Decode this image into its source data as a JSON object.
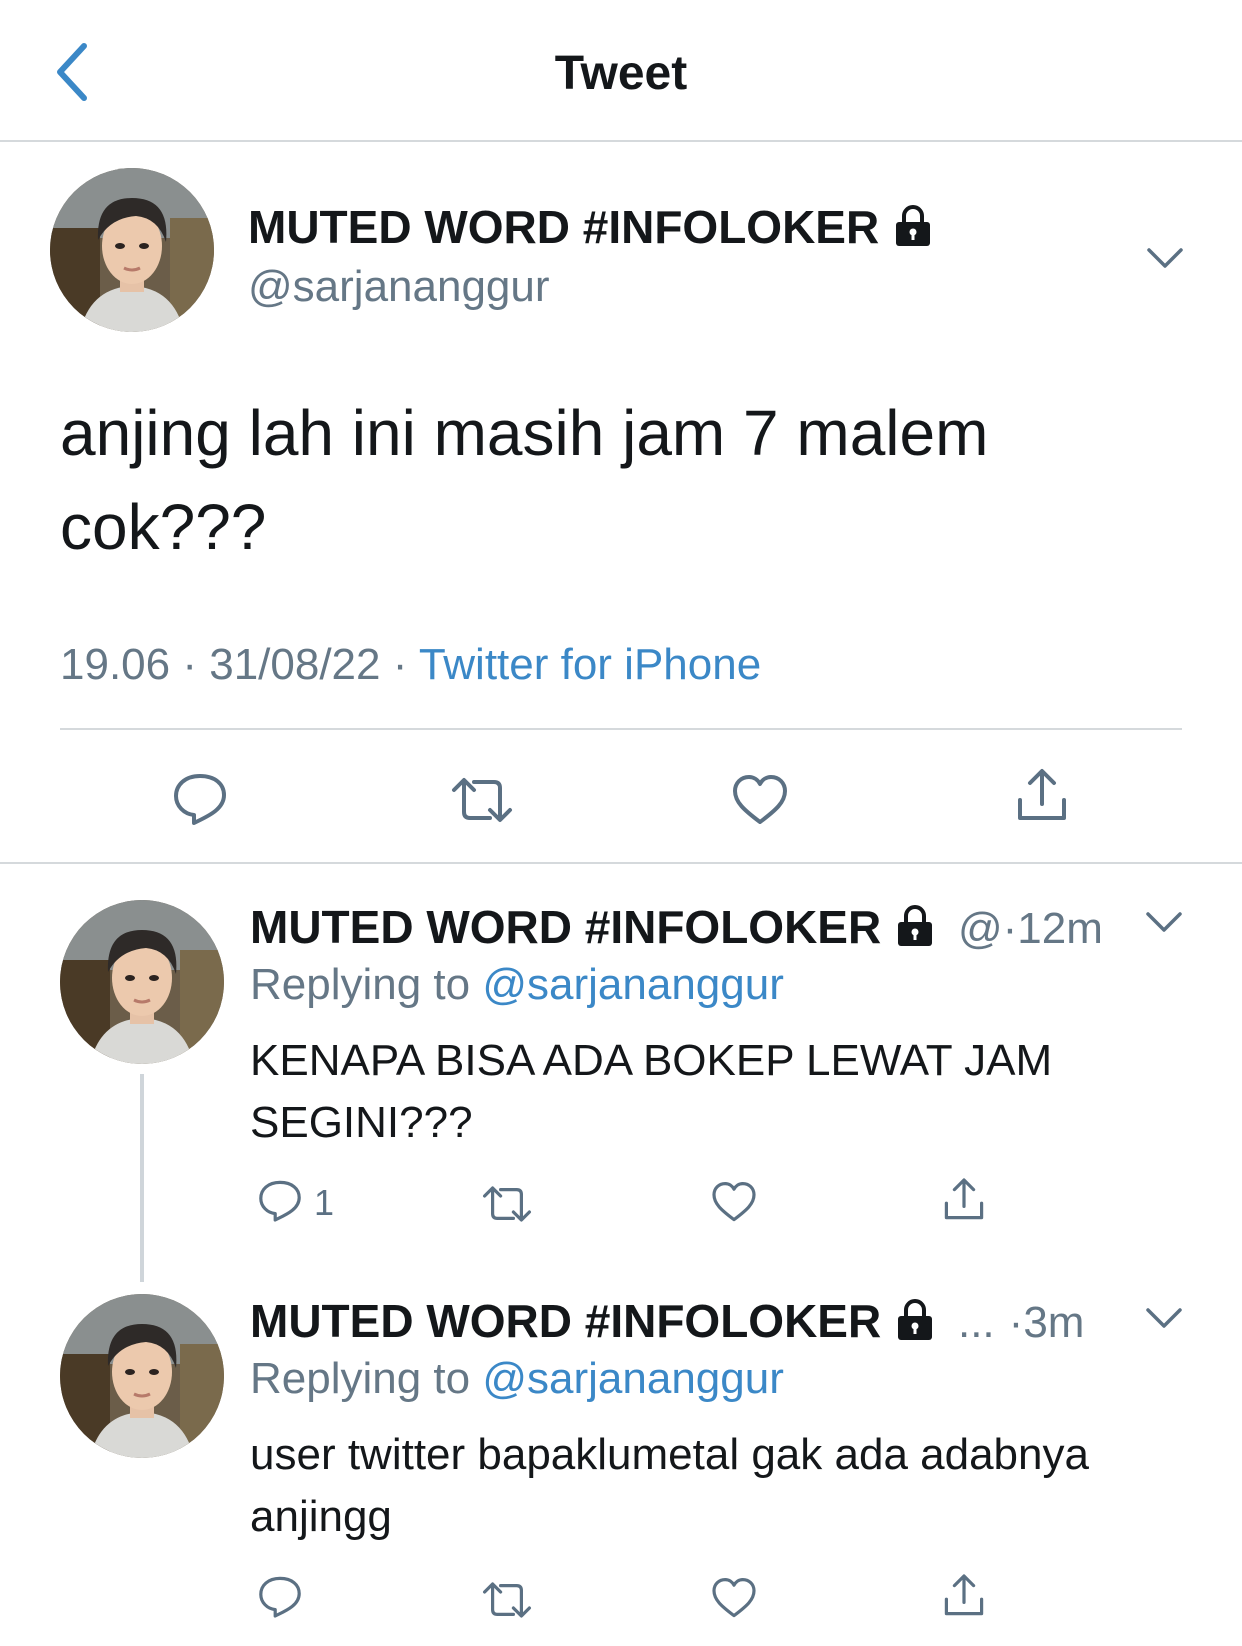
{
  "header": {
    "title": "Tweet"
  },
  "main_tweet": {
    "display_name": "MUTED WORD #INFOLOKER",
    "handle": "@sarjananggur",
    "text_line1": "anjing lah ini masih jam 7 malem",
    "text_line2": "cok???",
    "time": "19.06",
    "sep1": " · ",
    "date": "31/08/22",
    "sep2": " · ",
    "source": "Twitter for iPhone"
  },
  "reply1": {
    "display_name": "MUTED WORD #INFOLOKER",
    "handle_truncated": "@",
    "time": "·12m",
    "replying_prefix": "Replying to ",
    "replying_handle": "@sarjananggur",
    "text_line1": "KENAPA BISA ADA BOKEP LEWAT JAM",
    "text_line2": "SEGINI???",
    "reply_count": "1"
  },
  "reply2": {
    "display_name": "MUTED WORD #INFOLOKER",
    "handle_truncated": "...",
    "time": "·3m",
    "replying_prefix": "Replying to ",
    "replying_handle": "@sarjananggur",
    "text_line1": "user twitter bapaklumetal gak ada adabnya",
    "text_line2": "anjingg"
  },
  "colors": {
    "accent": "#3b88c7",
    "muted": "#657786",
    "divider": "#d5d9dc",
    "icon": "#5b7083"
  },
  "icons": [
    "back-chevron-icon",
    "lock-icon",
    "chevron-down-icon",
    "reply-icon",
    "retweet-icon",
    "like-icon",
    "share-icon"
  ]
}
